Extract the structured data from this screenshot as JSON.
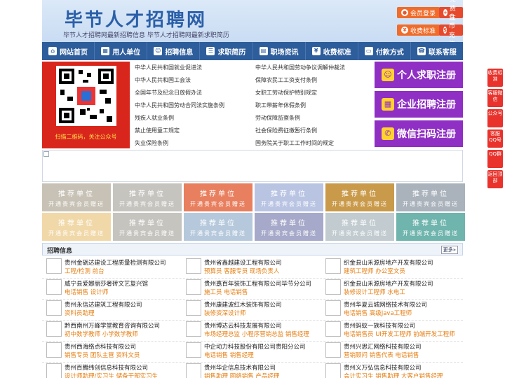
{
  "header": {
    "title": "毕节人才招聘网",
    "subtitle": "毕节人才招聘网最新招聘信息   毕节人才招聘网最新求职简历",
    "buttons": [
      "会员登录",
      "免费注册",
      "收费标准",
      "金币充值"
    ]
  },
  "nav": [
    "网站首页",
    "用人单位",
    "招聘信息",
    "求职简历",
    "职场资讯",
    "收费标准",
    "付款方式",
    "联系客服"
  ],
  "qr_caption": "扫描二维码，关注公众号",
  "laws": [
    "中华人民共和国就业促进法",
    "中华人民共和国劳动争议调解仲裁法",
    "中华人民共和国工会法",
    "保障农民工工资支付条例",
    "全国年节及纪念日放假办法",
    "女职工劳动保护特别规定",
    "中华人民共和国劳动合同法实施条例",
    "职工带薪年休假条例",
    "残疾人就业条例",
    "劳动保障监察条例",
    "禁止使用童工规定",
    "社会保险费征缴暂行条例",
    "失业保险条例",
    "国务院关于职工工作时间的规定"
  ],
  "register": [
    "个人求职注册",
    "企业招聘注册",
    "微信扫码注册"
  ],
  "tiles": {
    "title": "推荐单位",
    "sub": "开通贵宾会员赠送",
    "row1_colors": [
      "#c8c2b6",
      "#c6c4bf",
      "#e87f5f",
      "#b9c4e3",
      "#c99a4a",
      "#aab2bb"
    ],
    "row2_colors": [
      "#f1d8a8",
      "#c6c4bf",
      "#b6c9dc",
      "#a6a9c9",
      "#c1cbd0",
      "#6fb4ad"
    ]
  },
  "jobs_header": {
    "title": "招聘信息",
    "more": "更多»"
  },
  "jobs": [
    [
      {
        "company": "贵州金砺达建设工程质量检测有限公司",
        "positions": "工程/检测  前台"
      },
      {
        "company": "威宁县爱娜丽莎奢砖文艺复兴馆",
        "positions": "电话销售  设计师"
      },
      {
        "company": "贵州永信达建筑工程有限公司",
        "positions": "资料员助理"
      },
      {
        "company": "黔西南州万峰学堂教育咨询有限公司",
        "positions": "初中数学教师  小学数学教师"
      },
      {
        "company": "贵州西海络点科技有限公司",
        "positions": "销售专员  团队主管  资料文员"
      },
      {
        "company": "贵州百腾纬创信息科技有限公司",
        "positions": "设计师助理/实习生  储备干部实习生"
      }
    ],
    [
      {
        "company": "贵州省鑫越建设工程有限公司",
        "positions": "预算员  客服专员  现场负责人"
      },
      {
        "company": "贵州嘉百年装饰工程有限公司毕节分公司",
        "positions": "施工员  电话销售"
      },
      {
        "company": "贵州康建波红木装饰有限公司",
        "positions": "装修资深设计师"
      },
      {
        "company": "贵州博达云科技发展有限公司",
        "positions": "市场经理总监  小程序营销总监  销售经理"
      },
      {
        "company": "中企动力科技股份有限公司贵阳分公司",
        "positions": "电话销售  销售经理"
      },
      {
        "company": "贵州华企信息技术有限公司",
        "positions": "销售助理  网络销售  产品经理"
      }
    ],
    [
      {
        "company": "织金县山禾源房地产开发有限公司",
        "positions": "建筑工程师  办公室文员"
      },
      {
        "company": "织金县山禾源房地产开发有限公司",
        "positions": "装修设计工程师  水电工"
      },
      {
        "company": "贵州华夏云城网络技术有限公司",
        "positions": "电话销售  高级Java工程师"
      },
      {
        "company": "贵州蚂蚁一族科技有限公司",
        "positions": "电话销售员  UI开发工程师  前端开发工程师"
      },
      {
        "company": "贵州兴思汇网络科技有限公司",
        "positions": "营销顾问  销售代表  电话销售"
      },
      {
        "company": "贵州义万弘信息科技有限公司",
        "positions": "会计实习生  销售助理  大客户销售经理"
      }
    ]
  ],
  "float": [
    "收费标准",
    "客服微信",
    "公众号",
    "客服QQ号",
    "QQ群",
    "返回顶部"
  ]
}
